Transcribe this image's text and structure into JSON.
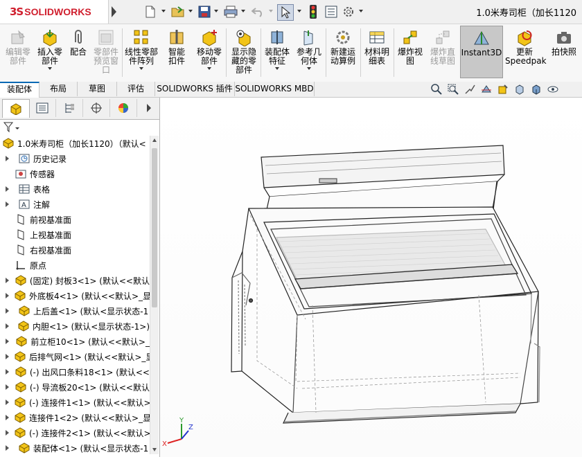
{
  "app": {
    "logo_prefix": "3S",
    "logo_text": "SOLIDWORKS",
    "title": "1.0米寿司柜（加长1120"
  },
  "ribbon": {
    "buttons": [
      {
        "label": "编辑零部件",
        "disabled": true
      },
      {
        "label": "插入零部件",
        "disabled": false
      },
      {
        "label": "配合",
        "disabled": false
      },
      {
        "label": "零部件预览窗口",
        "disabled": true
      },
      {
        "label": "线性零部件阵列",
        "disabled": false
      },
      {
        "label": "智能扣件",
        "disabled": false
      },
      {
        "label": "移动零部件",
        "disabled": false
      },
      {
        "label": "显示隐藏的零部件",
        "disabled": false
      },
      {
        "label": "装配体特征",
        "disabled": false
      },
      {
        "label": "参考几何体",
        "disabled": false
      },
      {
        "label": "新建运动算例",
        "disabled": false
      },
      {
        "label": "材料明细表",
        "disabled": false
      },
      {
        "label": "爆炸视图",
        "disabled": false
      },
      {
        "label": "爆炸直线草图",
        "disabled": true
      },
      {
        "label": "Instant3D",
        "disabled": false
      },
      {
        "label": "更新Speedpak",
        "disabled": false
      },
      {
        "label": "拍快照",
        "disabled": false
      }
    ]
  },
  "tabs": [
    "装配体",
    "布局",
    "草图",
    "评估",
    "SOLIDWORKS 插件",
    "SOLIDWORKS MBD"
  ],
  "tree": {
    "root": "1.0米寿司柜（加长1120）（默认<",
    "items": [
      {
        "label": "历史记录",
        "expandable": true
      },
      {
        "label": "传感器",
        "expandable": false
      },
      {
        "label": "表格",
        "expandable": true
      },
      {
        "label": "注解",
        "expandable": true
      },
      {
        "label": "前视基准面",
        "expandable": false
      },
      {
        "label": "上视基准面",
        "expandable": false
      },
      {
        "label": "右视基准面",
        "expandable": false
      },
      {
        "label": "原点",
        "expandable": false
      },
      {
        "label": "(固定) 封板3<1> (默认<<默认",
        "expandable": true
      },
      {
        "label": "外底板4<1> (默认<<默认>_显",
        "expandable": true
      },
      {
        "label": "上后盖<1> (默认<显示状态-1",
        "expandable": true
      },
      {
        "label": "内胆<1> (默认<显示状态-1>)",
        "expandable": true
      },
      {
        "label": "前立柜10<1> (默认<<默认>_",
        "expandable": true
      },
      {
        "label": "后排气网<1> (默认<<默认>_显",
        "expandable": true
      },
      {
        "label": "(-) 出风口条料18<1> (默认<<",
        "expandable": true
      },
      {
        "label": "(-) 导流板20<1> (默认<<默认",
        "expandable": true
      },
      {
        "label": "(-) 连接件1<1> (默认<<默认>",
        "expandable": true
      },
      {
        "label": "连接件1<2> (默认<<默认>_显",
        "expandable": true
      },
      {
        "label": "(-) 连接件2<1> (默认<<默认>",
        "expandable": true
      },
      {
        "label": "装配体<1> (默认<显示状态-1",
        "expandable": true
      }
    ]
  },
  "triad": {
    "x": "X",
    "y": "Y",
    "z": "Z"
  },
  "colors": {
    "brand_red": "#d01f2e",
    "tab_accent": "#0069b4",
    "part_yellow": "#f2c418"
  }
}
